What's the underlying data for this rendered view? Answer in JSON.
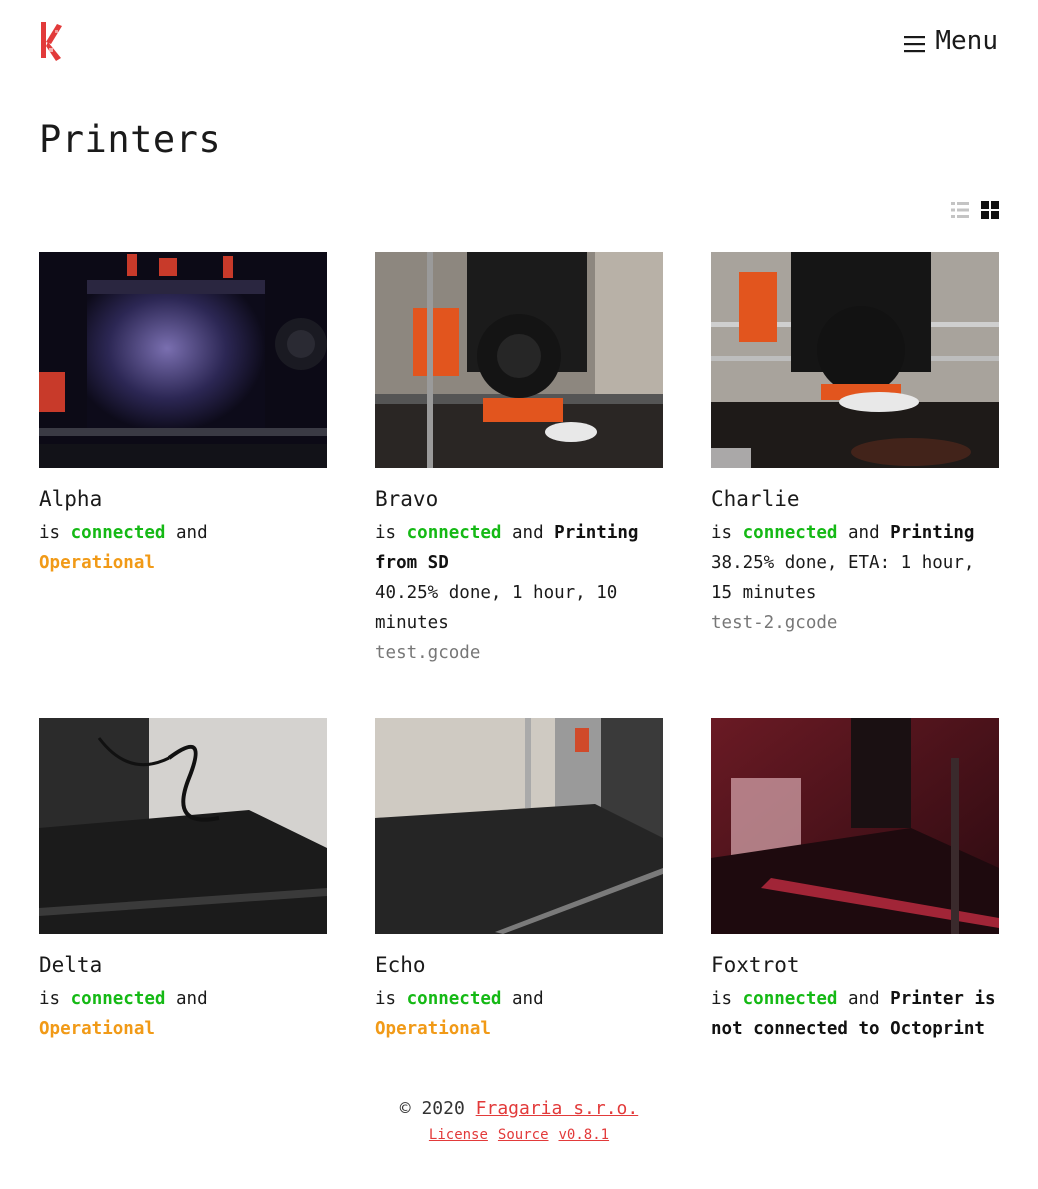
{
  "header": {
    "menu_label": "Menu"
  },
  "page": {
    "title": "Printers"
  },
  "view_modes": [
    "list",
    "grid"
  ],
  "printers": [
    {
      "name": "Alpha",
      "is": "is",
      "connection": "connected",
      "and": "and",
      "state": "Operational",
      "state_kind": "operational",
      "progress": "",
      "file": ""
    },
    {
      "name": "Bravo",
      "is": "is",
      "connection": "connected",
      "and": "and",
      "state": "Printing from SD",
      "state_kind": "printing",
      "progress": "40.25% done, 1 hour, 10 minutes",
      "file": "test.gcode"
    },
    {
      "name": "Charlie",
      "is": "is",
      "connection": "connected",
      "and": "and",
      "state": "Printing",
      "state_kind": "printing",
      "progress": "38.25% done, ETA: 1 hour, 15 minutes",
      "file": "test-2.gcode"
    },
    {
      "name": "Delta",
      "is": "is",
      "connection": "connected",
      "and": "and",
      "state": "Operational",
      "state_kind": "operational",
      "progress": "",
      "file": ""
    },
    {
      "name": "Echo",
      "is": "is",
      "connection": "connected",
      "and": "and",
      "state": "Operational",
      "state_kind": "operational",
      "progress": "",
      "file": ""
    },
    {
      "name": "Foxtrot",
      "is": "is",
      "connection": "connected",
      "and": "and",
      "state": "Printer is not connected to Octoprint",
      "state_kind": "disconnected",
      "progress": "",
      "file": ""
    }
  ],
  "footer": {
    "copyright": "© 2020",
    "company": "Fragaria s.r.o.",
    "license": "License",
    "source": "Source",
    "version": "v0.8.1"
  },
  "colors": {
    "accent": "#e23a3a",
    "connected": "#15b915",
    "operational": "#f19a17"
  }
}
